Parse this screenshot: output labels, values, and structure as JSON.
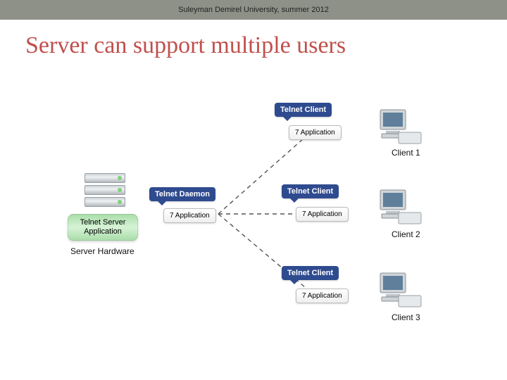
{
  "header": {
    "text": "Suleyman Demirel University, summer 2012"
  },
  "title": "Server can support multiple users",
  "server": {
    "app_label": "Telnet Server\nApplication",
    "hw_label": "Server Hardware"
  },
  "daemon": {
    "callout": "Telnet Daemon",
    "layer": "7 Application"
  },
  "clients": [
    {
      "callout": "Telnet Client",
      "layer": "7 Application",
      "label": "Client 1"
    },
    {
      "callout": "Telnet Client",
      "layer": "7 Application",
      "label": "Client 2"
    },
    {
      "callout": "Telnet Client",
      "layer": "7 Application",
      "label": "Client 3"
    }
  ]
}
